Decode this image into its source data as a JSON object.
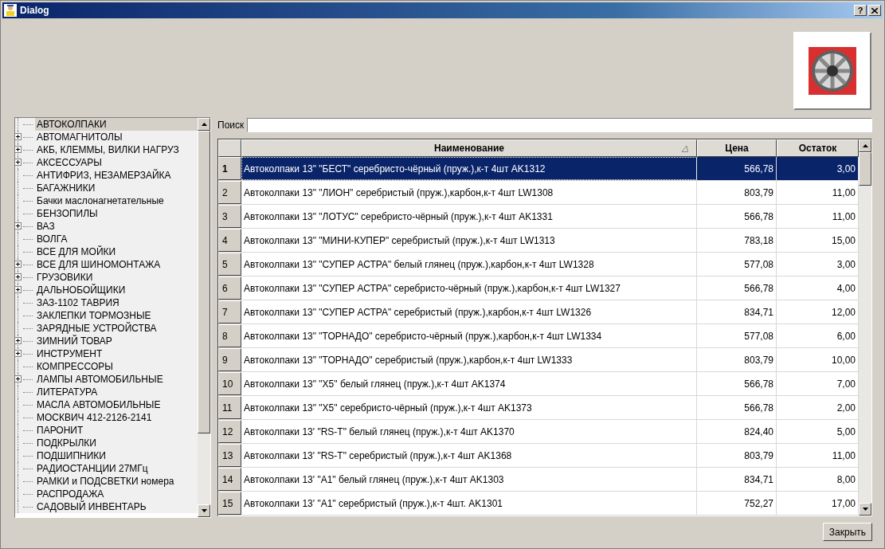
{
  "window": {
    "title": "Dialog",
    "help_button": "?"
  },
  "tree": {
    "items": [
      {
        "label": "АВТОКОЛПАКИ",
        "expandable": false,
        "selected": true
      },
      {
        "label": "АВТОМАГНИТОЛЫ",
        "expandable": true,
        "selected": false
      },
      {
        "label": "АКБ, КЛЕММЫ, ВИЛКИ НАГРУЗ",
        "expandable": true,
        "selected": false
      },
      {
        "label": "АКСЕССУАРЫ",
        "expandable": true,
        "selected": false
      },
      {
        "label": "АНТИФРИЗ, НЕЗАМЕРЗАЙКА",
        "expandable": false,
        "selected": false
      },
      {
        "label": "БАГАЖНИКИ",
        "expandable": false,
        "selected": false
      },
      {
        "label": "Бачки маслонагнетательные",
        "expandable": false,
        "selected": false
      },
      {
        "label": "БЕНЗОПИЛЫ",
        "expandable": false,
        "selected": false
      },
      {
        "label": "ВАЗ",
        "expandable": true,
        "selected": false
      },
      {
        "label": "ВОЛГА",
        "expandable": false,
        "selected": false
      },
      {
        "label": "ВСЕ ДЛЯ МОЙКИ",
        "expandable": false,
        "selected": false
      },
      {
        "label": "ВСЕ ДЛЯ ШИНОМОНТАЖА",
        "expandable": true,
        "selected": false
      },
      {
        "label": "ГРУЗОВИКИ",
        "expandable": true,
        "selected": false
      },
      {
        "label": "ДАЛЬНОБОЙЩИКИ",
        "expandable": true,
        "selected": false
      },
      {
        "label": "ЗАЗ-1102 ТАВРИЯ",
        "expandable": false,
        "selected": false
      },
      {
        "label": "ЗАКЛЕПКИ ТОРМОЗНЫЕ",
        "expandable": false,
        "selected": false
      },
      {
        "label": "ЗАРЯДНЫЕ УСТРОЙСТВА",
        "expandable": false,
        "selected": false
      },
      {
        "label": "ЗИМНИЙ ТОВАР",
        "expandable": true,
        "selected": false
      },
      {
        "label": "ИНСТРУМЕНТ",
        "expandable": true,
        "selected": false
      },
      {
        "label": "КОМПРЕССОРЫ",
        "expandable": false,
        "selected": false
      },
      {
        "label": "ЛАМПЫ АВТОМОБИЛЬНЫЕ",
        "expandable": true,
        "selected": false
      },
      {
        "label": "ЛИТЕРАТУРА",
        "expandable": false,
        "selected": false
      },
      {
        "label": "МАСЛА АВТОМОБИЛЬНЫЕ",
        "expandable": false,
        "selected": false
      },
      {
        "label": "МОСКВИЧ 412-2126-2141",
        "expandable": false,
        "selected": false
      },
      {
        "label": "ПАРОНИТ",
        "expandable": false,
        "selected": false
      },
      {
        "label": "ПОДКРЫЛКИ",
        "expandable": false,
        "selected": false
      },
      {
        "label": "ПОДШИПНИКИ",
        "expandable": false,
        "selected": false
      },
      {
        "label": "РАДИОСТАНЦИИ 27МГц",
        "expandable": false,
        "selected": false
      },
      {
        "label": "РАМКИ и ПОДСВЕТКИ номера",
        "expandable": false,
        "selected": false
      },
      {
        "label": "РАСПРОДАЖА",
        "expandable": false,
        "selected": false
      },
      {
        "label": "САДОВЫЙ ИНВЕНТАРЬ",
        "expandable": false,
        "selected": false
      }
    ]
  },
  "search": {
    "label": "Поиск"
  },
  "table": {
    "columns": [
      "Наименование",
      "Цена",
      "Остаток"
    ],
    "rows": [
      {
        "num": "1",
        "name": "Автоколпаки 13\" \"БЕСТ\" серебристо-чёрный (пруж.),к-т 4шт  AK1312",
        "price": "566,78",
        "stock": "3,00",
        "selected": true
      },
      {
        "num": "2",
        "name": "Автоколпаки 13\" \"ЛИОН\" серебристый (пруж.),карбон,к-т 4шт  LW1308",
        "price": "803,79",
        "stock": "11,00",
        "selected": false
      },
      {
        "num": "3",
        "name": "Автоколпаки 13\" \"ЛОТУС\" серебристо-чёрный (пруж.),к-т 4шт  AK1331",
        "price": "566,78",
        "stock": "11,00",
        "selected": false
      },
      {
        "num": "4",
        "name": "Автоколпаки 13\" \"МИНИ-КУПЕР\" серебристый (пруж.),к-т 4шт  LW1313",
        "price": "783,18",
        "stock": "15,00",
        "selected": false
      },
      {
        "num": "5",
        "name": "Автоколпаки 13\" \"СУПЕР АСТРА\" белый глянец (пруж.),карбон,к-т 4шт   LW1328",
        "price": "577,08",
        "stock": "3,00",
        "selected": false
      },
      {
        "num": "6",
        "name": "Автоколпаки 13\" \"СУПЕР АСТРА\" серебристо-чёрный (пруж.),карбон,к-т 4шт  LW1327",
        "price": "566,78",
        "stock": "4,00",
        "selected": false
      },
      {
        "num": "7",
        "name": "Автоколпаки 13\" \"СУПЕР АСТРА\" серебристый (пруж.),карбон,к-т 4шт  LW1326",
        "price": "834,71",
        "stock": "12,00",
        "selected": false
      },
      {
        "num": "8",
        "name": "Автоколпаки 13\" \"ТОРНАДО\" серебристо-чёрный (пруж.),карбон,к-т 4шт   LW1334",
        "price": "577,08",
        "stock": "6,00",
        "selected": false
      },
      {
        "num": "9",
        "name": "Автоколпаки 13\" \"ТОРНАДО\" серебристый (пруж.),карбон,к-т 4шт  LW1333",
        "price": "803,79",
        "stock": "10,00",
        "selected": false
      },
      {
        "num": "10",
        "name": "Автоколпаки 13\" \"X5\" белый глянец (пруж.),к-т 4шт  AK1374",
        "price": "566,78",
        "stock": "7,00",
        "selected": false
      },
      {
        "num": "11",
        "name": "Автоколпаки 13\" \"X5\" серебристо-чёрный (пруж.),к-т 4шт  AK1373",
        "price": "566,78",
        "stock": "2,00",
        "selected": false
      },
      {
        "num": "12",
        "name": "Автоколпаки 13' \"RS-T\" белый глянец (пруж.),к-т 4шт  AK1370",
        "price": "824,40",
        "stock": "5,00",
        "selected": false
      },
      {
        "num": "13",
        "name": "Автоколпаки 13' \"RS-T\" серебристый (пруж.),к-т 4шт  AK1368",
        "price": "803,79",
        "stock": "11,00",
        "selected": false
      },
      {
        "num": "14",
        "name": "Автоколпаки 13' \"A1\" белый глянец (пруж.),к-т 4шт  AK1303",
        "price": "834,71",
        "stock": "8,00",
        "selected": false
      },
      {
        "num": "15",
        "name": "Автоколпаки 13' \"A1\" серебристый (пруж.),к-т 4шт.  AK1301",
        "price": "752,27",
        "stock": "17,00",
        "selected": false
      }
    ]
  },
  "buttons": [
    "Закрыть"
  ]
}
